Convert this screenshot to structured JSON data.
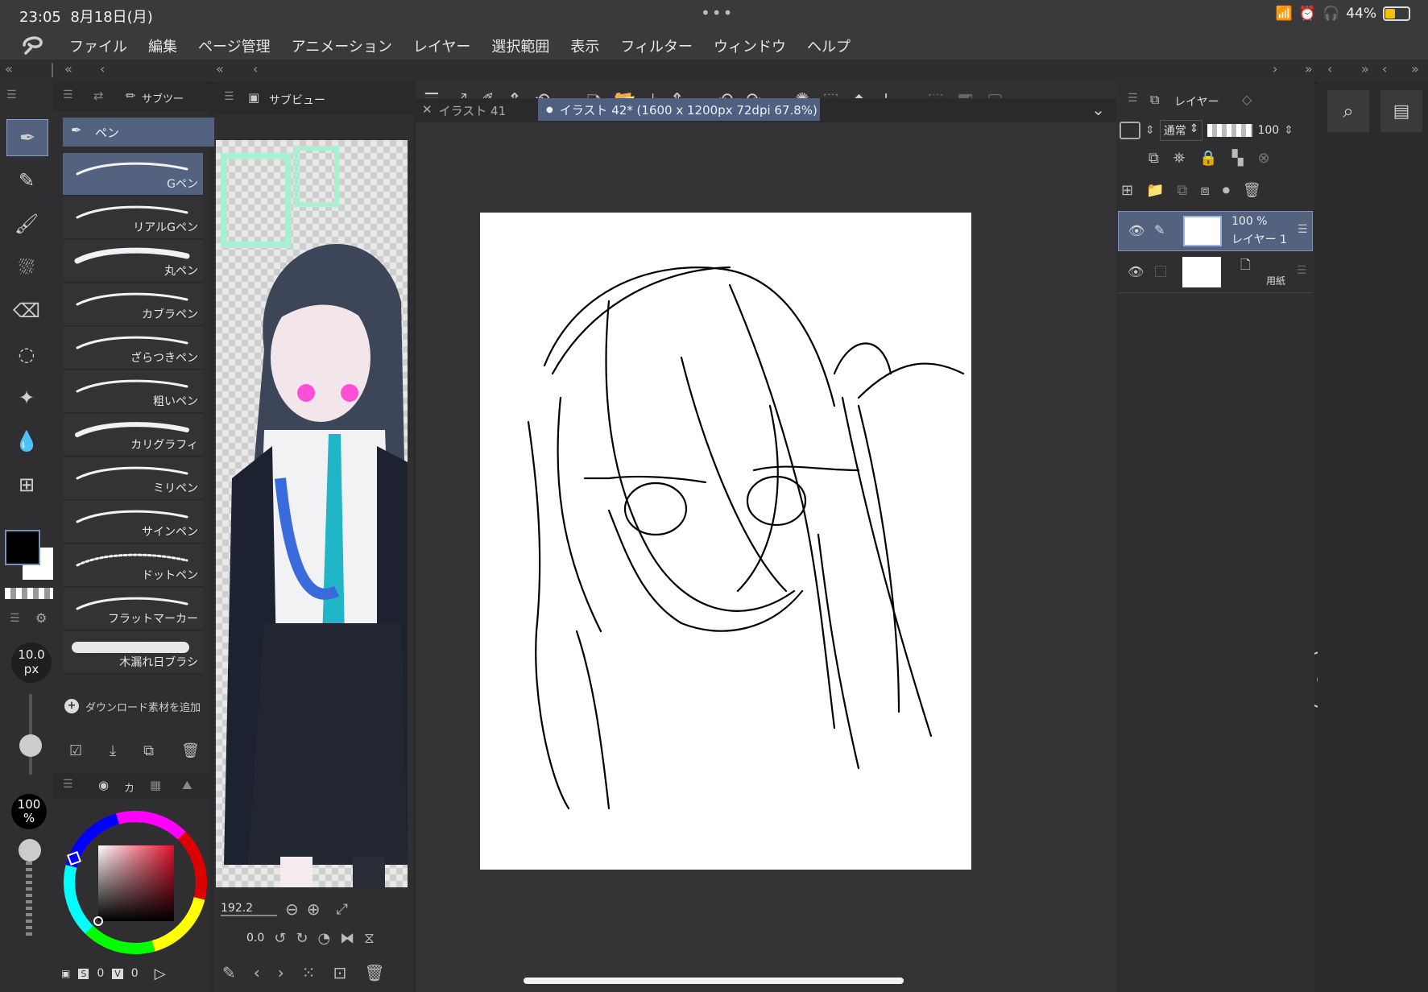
{
  "status": {
    "time": "23:05",
    "date": "8月18日(月)",
    "battery": "44%"
  },
  "menu": [
    "ファイル",
    "編集",
    "ページ管理",
    "アニメーション",
    "レイヤー",
    "選択範囲",
    "表示",
    "フィルター",
    "ウィンドウ",
    "ヘルプ"
  ],
  "subtool_panel": {
    "tab_label": "サブツー",
    "group_label": "ペン",
    "brushes": [
      "Gペン",
      "リアルGペン",
      "丸ペン",
      "カブラペン",
      "ざらつきペン",
      "粗いペン",
      "カリグラフィ",
      "ミリペン",
      "サインペン",
      "ドットペン",
      "フラットマーカー",
      "木漏れ日ブラシ"
    ],
    "add_download": "ダウンロード素材を追加"
  },
  "brush_size": {
    "value": "10.0",
    "unit": "px"
  },
  "opacity": {
    "value": "100",
    "unit": "%"
  },
  "color_panel": {
    "tab_label": "カ",
    "readout": [
      "S",
      "0",
      "V",
      "0"
    ]
  },
  "subview": {
    "tab_label": "サブビュー",
    "zoom": "192.2",
    "rotation": "0.0"
  },
  "canvas_tabs": [
    {
      "label": "イラスト 41",
      "active": false
    },
    {
      "label": "イラスト 42* (1600 x 1200px 72dpi 67.8%)",
      "active": true
    }
  ],
  "layers": {
    "tab_label": "レイヤー",
    "blend_mode": "通常",
    "opacity": "100",
    "items": [
      {
        "name": "レイヤー 1",
        "opacity": "100 %",
        "selected": true
      },
      {
        "name": "用紙",
        "opacity": "",
        "selected": false
      }
    ]
  },
  "colors": {
    "accent": "#4e5f82",
    "highlight": "#52627f",
    "bg": "#2b2b2d",
    "primary": "#000000",
    "secondary": "#ffffff"
  }
}
